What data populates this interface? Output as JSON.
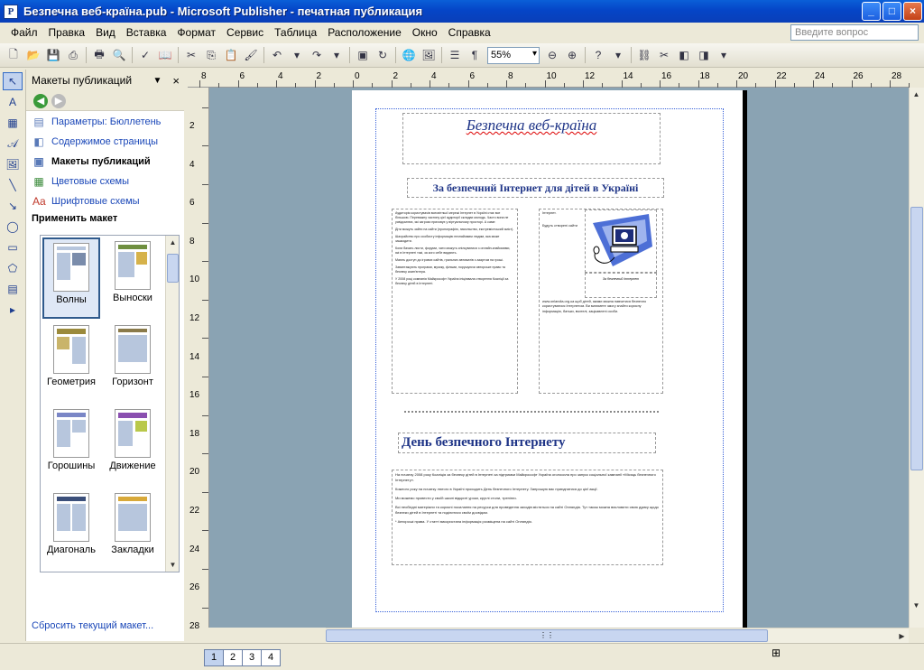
{
  "window": {
    "title": "Безпечна веб-країна.pub - Microsoft Publisher - печатная публикация"
  },
  "menu": [
    "Файл",
    "Правка",
    "Вид",
    "Вставка",
    "Формат",
    "Сервис",
    "Таблица",
    "Расположение",
    "Окно",
    "Справка"
  ],
  "help_placeholder": "Введите вопрос",
  "zoom": "55%",
  "taskpane": {
    "title": "Макеты публикаций",
    "links": [
      {
        "label": "Параметры: Бюллетень",
        "icon": "options-icon"
      },
      {
        "label": "Содержимое страницы",
        "icon": "page-content-icon"
      },
      {
        "label": "Макеты публикаций",
        "icon": "designs-icon",
        "current": true
      },
      {
        "label": "Цветовые схемы",
        "icon": "color-schemes-icon"
      },
      {
        "label": "Шрифтовые схемы",
        "icon": "font-schemes-icon"
      }
    ],
    "apply_label": "Применить макет",
    "designs": [
      "Волны",
      "Выноски",
      "Геометрия",
      "Горизонт",
      "Горошины",
      "Движение",
      "Диагональ",
      "Закладки"
    ],
    "reset_label": "Сбросить текущий макет..."
  },
  "ruler": {
    "h": [
      "8",
      "6",
      "4",
      "2",
      "0",
      "2",
      "4",
      "6",
      "8",
      "10",
      "12",
      "14",
      "16",
      "18",
      "20",
      "22",
      "24",
      "26",
      "28"
    ],
    "v": [
      "2",
      "4",
      "6",
      "8",
      "10",
      "12",
      "14",
      "16",
      "18",
      "20",
      "22",
      "24",
      "26",
      "28"
    ]
  },
  "document": {
    "title": "Безпечна веб-країна",
    "subtitle": "За безпечний Інтернет для дітей в Україні",
    "col1": [
      "Аудиторія користувачів всесвітньої мережі Інтернет в Україні стає все більшою. Переважну частину цієї аудиторії складає молодь. Часто вона не усвідомлює, які загрози приховує у віртуальному просторі. А саме:",
      "Діти можуть зайти на сайти (пронографію, насильство, екстремістський зміст).",
      "Шахрайство про особисту інформацію незнайомим людям, яка може зашкодити.",
      "Коли бачать листи, форуми, чати можуть спілкуватися з онлайн-знайомими, які в Інтернеті такі, за кого себе видають.",
      "Мають доступ до ігрових сайтів, гральних автоматів з азартом на гроші.",
      "Завантажують програми, музику, фільми, порушуючи авторське право та безпеку комп'ютера.",
      "У 2008 році компанія Майкрософт Україна ініціювала створення Коаліції за безпеку дітей в Інтернеті."
    ],
    "col2_text": [
      "Інтернет.",
      "Будуть створені сайти"
    ],
    "picture_caption": "За безпечний Інтернет",
    "col2_foot": "www.onlandia.org.ua щоб дітей, якими можна навчитися безпечно користуватися Інтернетом. Ви матимете змогу знайти корисну інформацію, батьки, вчителі, зацікавлені особи.",
    "heading2": "День безпечного Інтернету",
    "col3": [
      "На початку 2008 року Коаліція за безпеку дітей в Інтернеті за підтримки Майкрософт Україна оголосила про запуск соціальної кампанії «Місяць безпечного Інтернету».",
      "Кожного року на початку лютого в Україні проходить День безпечного Інтернету. Запрошую вас приєднатися до цієї акції.",
      "Ми можемо провести у своїй школі відкриті уроки, круглі столи, тренінги.",
      "Всі необхідні матеріали та корисні посилання на ресурси для проведення заходів містяться на сайті Онляндія. Тут також можна висловити свою думку щодо безпеки дітей в Інтернеті та поділитися своїм досвідом.",
      "* Авторські права. У статті використана інформація розміщена на сайті Онляндія."
    ]
  },
  "pages": [
    "1",
    "2",
    "3",
    "4"
  ]
}
